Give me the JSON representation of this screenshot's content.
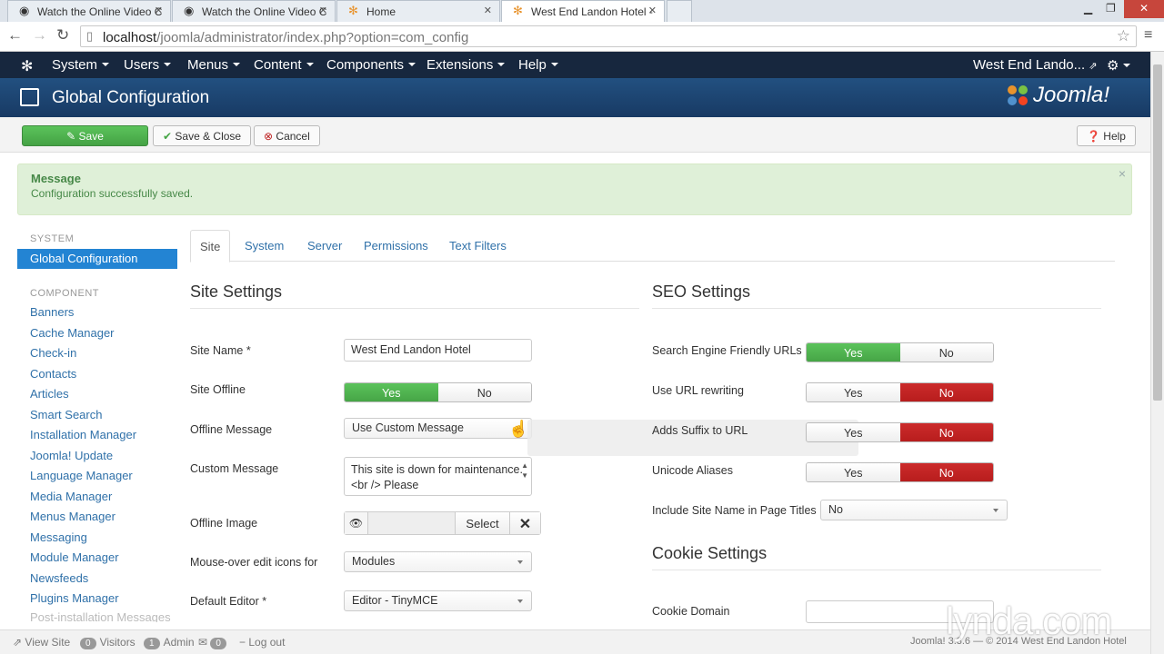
{
  "browser": {
    "tabs": [
      {
        "title": "Watch the Online Video C",
        "icon": "lynda-favicon"
      },
      {
        "title": "Watch the Online Video C",
        "icon": "lynda-favicon"
      },
      {
        "title": "Home",
        "icon": "joomla-favicon"
      },
      {
        "title": "West End Landon Hotel -",
        "icon": "joomla-favicon"
      }
    ],
    "url_host": "localhost",
    "url_path": "/joomla/administrator/index.php?option=com_config"
  },
  "topnav": {
    "items": [
      "System",
      "Users",
      "Menus",
      "Content",
      "Components",
      "Extensions",
      "Help"
    ],
    "site_link": "West End Lando..."
  },
  "page_title": "Global Configuration",
  "logo_text": "Joomla!",
  "toolbar": {
    "save": "Save",
    "save_close": "Save & Close",
    "cancel": "Cancel",
    "help": "Help"
  },
  "message": {
    "heading": "Message",
    "text": "Configuration successfully saved."
  },
  "sidebar": {
    "system_heading": "SYSTEM",
    "active": "Global Configuration",
    "component_heading": "COMPONENT",
    "items": [
      "Banners",
      "Cache Manager",
      "Check-in",
      "Contacts",
      "Articles",
      "Smart Search",
      "Installation Manager",
      "Joomla! Update",
      "Language Manager",
      "Media Manager",
      "Menus Manager",
      "Messaging",
      "Module Manager",
      "Newsfeeds",
      "Plugins Manager",
      "Post-installation Messages"
    ]
  },
  "tabs": [
    "Site",
    "System",
    "Server",
    "Permissions",
    "Text Filters"
  ],
  "site_settings": {
    "heading": "Site Settings",
    "site_name_label": "Site Name *",
    "site_name_value": "West End Landon Hotel",
    "site_offline_label": "Site Offline",
    "offline_message_label": "Offline Message",
    "offline_message_value": "Use Custom Message",
    "custom_message_label": "Custom Message",
    "custom_message_value": "This site is down for maintenance.<br /> Please",
    "offline_image_label": "Offline Image",
    "select_label": "Select",
    "mouseover_label": "Mouse-over edit icons for",
    "mouseover_value": "Modules",
    "default_editor_label": "Default Editor *",
    "default_editor_value": "Editor - TinyMCE"
  },
  "toggle": {
    "yes": "Yes",
    "no": "No"
  },
  "seo_settings": {
    "heading": "SEO Settings",
    "sef_label": "Search Engine Friendly URLs",
    "rewrite_label": "Use URL rewriting",
    "suffix_label": "Adds Suffix to URL",
    "unicode_label": "Unicode Aliases",
    "sitename_label": "Include Site Name in Page Titles",
    "sitename_value": "No"
  },
  "cookie_settings": {
    "heading": "Cookie Settings",
    "domain_label": "Cookie Domain"
  },
  "statusbar": {
    "view_site": "View Site",
    "visitors_count": "0",
    "visitors": "Visitors",
    "admin_count": "1",
    "admin": "Admin",
    "msg_count": "0",
    "logout": "Log out",
    "footer": "Joomla! 3.3.6 — © 2014 West End Landon Hotel"
  },
  "watermark": "lynda.com",
  "colors": {
    "navbar": "#17273e",
    "accent": "#2384d3",
    "yes_green": "#46a546",
    "no_red": "#bd2020",
    "alert_bg": "#dff0d8"
  }
}
